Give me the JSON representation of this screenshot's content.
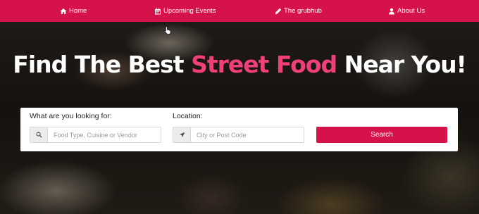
{
  "nav": {
    "items": [
      {
        "label": "Home",
        "icon": "home-icon"
      },
      {
        "label": "Upcoming Events",
        "icon": "calendar-icon"
      },
      {
        "label": "The grubhub",
        "icon": "pencil-icon"
      },
      {
        "label": "About Us",
        "icon": "user-icon"
      }
    ]
  },
  "hero": {
    "headline_part1": "Find The Best ",
    "headline_accent": "Street Food",
    "headline_part2": " Near You!"
  },
  "search": {
    "what_label": "What are you looking for:",
    "what_placeholder": "Food Type, Cuisine or Vendor",
    "what_icon": "search-icon",
    "location_label": "Location:",
    "location_placeholder": "City or Post Code",
    "location_icon": "location-arrow-icon",
    "button_label": "Search"
  },
  "colors": {
    "brand": "#d6124a",
    "accent_text": "#f0407a"
  }
}
